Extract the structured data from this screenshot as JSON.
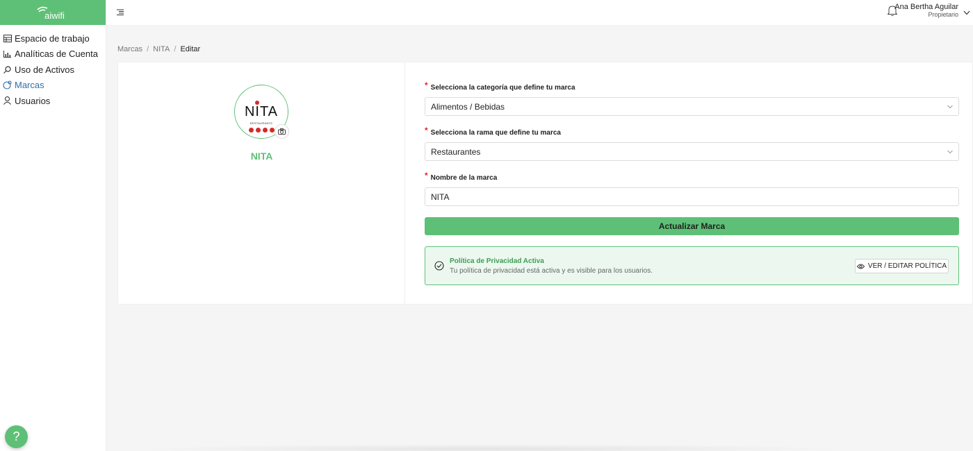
{
  "sidebar": {
    "logo_text": "aiwifi",
    "items": [
      {
        "label": "Espacio de trabajo",
        "icon": "table-icon"
      },
      {
        "label": "Analíticas de Cuenta",
        "icon": "bar-chart-icon"
      },
      {
        "label": "Uso de Activos",
        "icon": "magnifier-icon"
      },
      {
        "label": "Marcas",
        "icon": "brand-icon",
        "active": true
      },
      {
        "label": "Usuarios",
        "icon": "user-icon"
      }
    ],
    "help_label": "?"
  },
  "topbar": {
    "user_name": "Ana Bertha Aguilar",
    "user_role": "Propietario"
  },
  "breadcrumb": {
    "items": [
      "Marcas",
      "NITA",
      "Editar"
    ]
  },
  "brand": {
    "name": "NITA",
    "logo_word": "NITA",
    "logo_sub": "RESTAURANTE"
  },
  "form": {
    "category_label": "Selecciona la categoría que define tu marca",
    "category_value": "Alimentos / Bebidas",
    "branch_label": "Selecciona la rama que define tu marca",
    "branch_value": "Restaurantes",
    "name_label": "Nombre de la marca",
    "name_value": "NITA",
    "required_mark": "*",
    "submit_label": "Actualizar Marca"
  },
  "policy": {
    "title": "Política de Privacidad Activa",
    "description": "Tu política de privacidad está activa y es visible para los usuarios.",
    "button_label": "VER / EDITAR POLÍTICA"
  },
  "colors": {
    "accent": "#5ec076",
    "active_nav": "#2f6fab",
    "required": "#e0262d"
  }
}
